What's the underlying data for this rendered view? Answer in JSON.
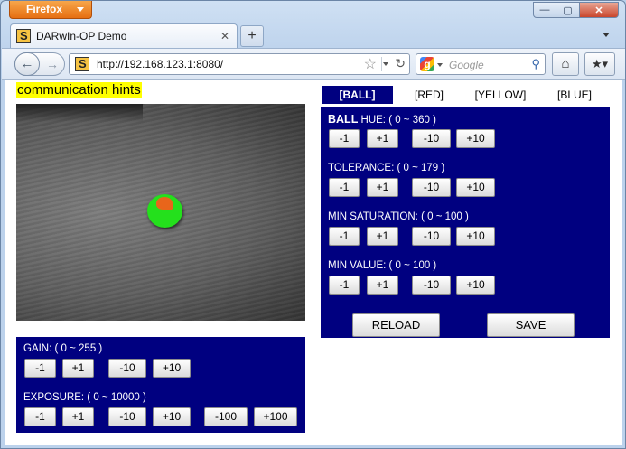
{
  "browser": {
    "app_button": "Firefox",
    "tab_title": "DARwIn-OP Demo",
    "url": "http://192.168.123.1:8080/",
    "search_placeholder": "Google",
    "window_controls": {
      "minimize": "—",
      "maximize": "▢",
      "close": "✕"
    }
  },
  "page": {
    "hint_text": "communication hints",
    "camera": {
      "description_icon": "camera-feed-ball"
    },
    "gain_panel": {
      "gain_label": "GAIN: ( 0 ~ 255 )",
      "gain_buttons": [
        "-1",
        "+1",
        "-10",
        "+10"
      ],
      "exposure_label": "EXPOSURE: ( 0 ~ 10000 )",
      "exposure_buttons": [
        "-1",
        "+1",
        "-10",
        "+10",
        "-100",
        "+100"
      ]
    },
    "color_tabs": [
      "[BALL]",
      "[RED]",
      "[YELLOW]",
      "[BLUE]"
    ],
    "active_color_tab": "[BALL]",
    "color_panel": {
      "hue_prefix": "BALL",
      "hue_label": " HUE: ( 0 ~ 360 )",
      "tolerance_label": "TOLERANCE: ( 0 ~ 179 )",
      "saturation_label": "MIN SATURATION: ( 0 ~ 100 )",
      "value_label": "MIN VALUE: ( 0 ~ 100 )",
      "step_buttons": [
        "-1",
        "+1",
        "-10",
        "+10"
      ],
      "reload_label": "RELOAD",
      "save_label": "SAVE"
    }
  },
  "colors": {
    "panel_bg": "#000080",
    "hint_bg": "#ffff00",
    "ball": "#24e01c",
    "ball_slice": "#e8651b"
  }
}
